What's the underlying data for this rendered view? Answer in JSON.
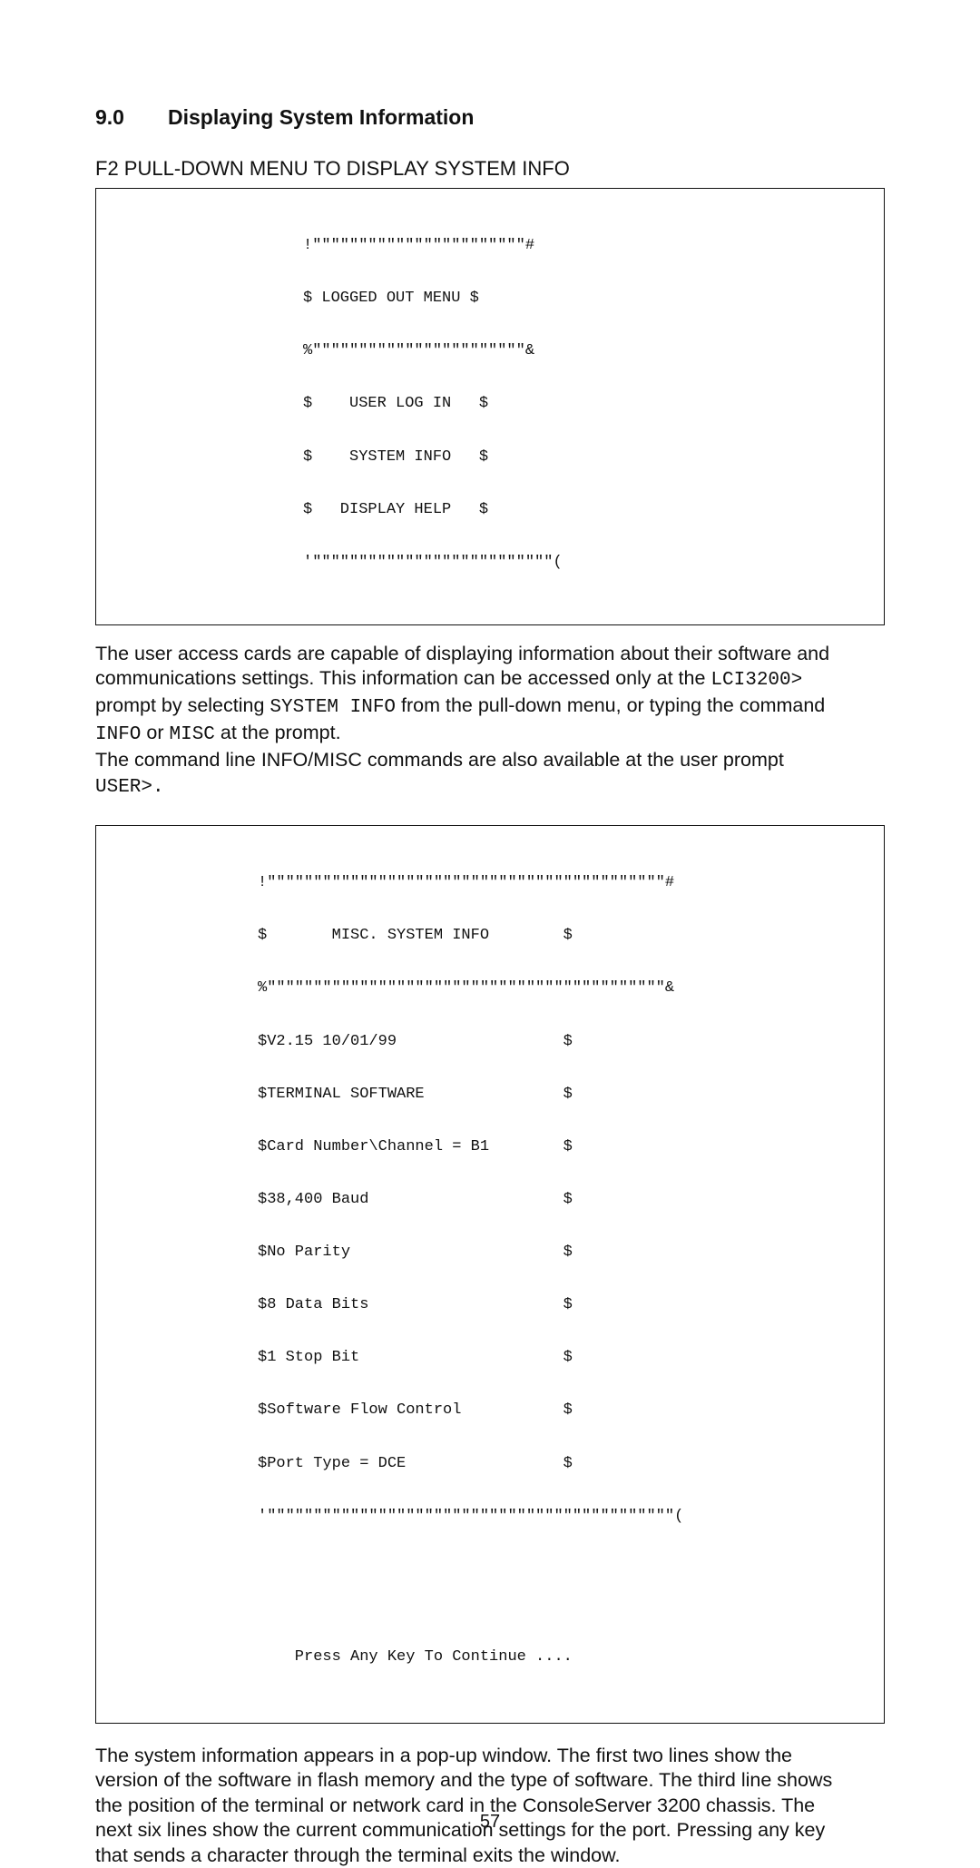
{
  "section": {
    "number": "9.0",
    "title": "Displaying System Information"
  },
  "subhead1": "F2 PULL-DOWN MENU TO DISPLAY SYSTEM INFO",
  "term1": {
    "top": "!\"\"\"\"\"\"\"\"\"\"\"\"\"\"\"\"\"\"\"\"\"\"\"#",
    "head": "$ LOGGED OUT MENU $",
    "sep": "%\"\"\"\"\"\"\"\"\"\"\"\"\"\"\"\"\"\"\"\"\"\"\"&",
    "i1": "$    USER LOG IN   $",
    "i2": "$    SYSTEM INFO   $",
    "i3": "$   DISPLAY HELP   $",
    "bottom": "'\"\"\"\"\"\"\"\"\"\"\"\"\"\"\"\"\"\"\"\"\"\"\"\"\"\"("
  },
  "para1": {
    "a1": "The user access cards are capable of displaying information about their software and",
    "a2": "communications settings.  This information can be accessed only at the ",
    "m1": "LCI3200>",
    "a3": "prompt by selecting ",
    "m2": "SYSTEM INFO",
    "a4": " from the pull-down menu, or typing the command",
    "m3": "INFO",
    "a5": " or ",
    "m4": "MISC",
    "a6": " at the prompt.",
    "a7": "The command line INFO/MISC commands are also available at the user prompt",
    "m5": "USER>."
  },
  "term2": {
    "top": "!\"\"\"\"\"\"\"\"\"\"\"\"\"\"\"\"\"\"\"\"\"\"\"\"\"\"\"\"\"\"\"\"\"\"\"\"\"\"\"\"\"\"\"#",
    "head": "$       MISC. SYSTEM INFO        $",
    "sep": "%\"\"\"\"\"\"\"\"\"\"\"\"\"\"\"\"\"\"\"\"\"\"\"\"\"\"\"\"\"\"\"\"\"\"\"\"\"\"\"\"\"\"\"&",
    "r1": "$V2.15 10/01/99                  $",
    "r2": "$TERMINAL SOFTWARE               $",
    "r3": "$Card Number\\Channel = B1        $",
    "r4": "$38,400 Baud                     $",
    "r5": "$No Parity                       $",
    "r6": "$8 Data Bits                     $",
    "r7": "$1 Stop Bit                      $",
    "r8": "$Software Flow Control           $",
    "r9": "$Port Type = DCE                 $",
    "bottom": "'\"\"\"\"\"\"\"\"\"\"\"\"\"\"\"\"\"\"\"\"\"\"\"\"\"\"\"\"\"\"\"\"\"\"\"\"\"\"\"\"\"\"\"\"(",
    "press": "    Press Any Key To Continue ...."
  },
  "para2": {
    "l1": "The system information appears in a pop-up window.  The first two lines show the",
    "l2": "version of the software in flash memory and the type of software.  The third line shows",
    "l3": "the position of the terminal or network card in the ConsoleServer 3200 chassis.  The",
    "l4": "next six lines show the current communication settings for the port.  Pressing any key",
    "l5": "that sends a character through the terminal exits the window."
  },
  "page_number": "57"
}
